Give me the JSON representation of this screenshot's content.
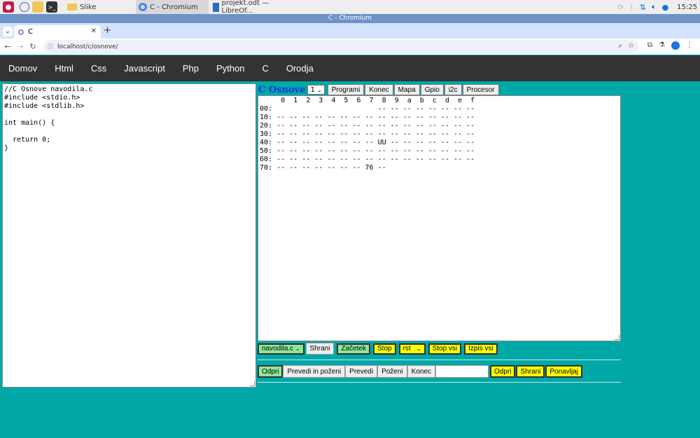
{
  "taskbar": {
    "tasks": [
      {
        "label": "Slike"
      },
      {
        "label": "C - Chromium"
      },
      {
        "label": "projekt.odt — LibreOf..."
      }
    ],
    "clock": "15:25"
  },
  "window": {
    "title": "C - Chromium"
  },
  "browser": {
    "tab_title": "C",
    "url": "localhost/c/osnove/"
  },
  "site_nav": [
    "Domov",
    "Html",
    "Css",
    "Javascript",
    "Php",
    "Python",
    "C",
    "Orodja"
  ],
  "editor": {
    "code": "//C Osnove navodila.c\n#include <stdio.h>\n#include <stdlib.h>\n\nint main() {\n\n  return 0;\n}"
  },
  "panel": {
    "heading": "C Osnove",
    "number_select": "1",
    "top_buttons": [
      "Programi",
      "Konec",
      "Mapa",
      "Gpio",
      "i2c",
      "Procesor"
    ],
    "output": "     0  1  2  3  4  5  6  7  8  9  a  b  c  d  e  f\n00:                         -- -- -- -- -- -- -- --\n10: -- -- -- -- -- -- -- -- -- -- -- -- -- -- -- --\n20: -- -- -- -- -- -- -- -- -- -- -- -- -- -- -- --\n30: -- -- -- -- -- -- -- -- -- -- -- -- -- -- -- --\n40: -- -- -- -- -- -- -- -- UU -- -- -- -- -- -- --\n50: -- -- -- -- -- -- -- -- -- -- -- -- -- -- -- --\n60: -- -- -- -- -- -- -- -- -- -- -- -- -- -- -- --\n70: -- -- -- -- -- -- -- 76 --",
    "file_select": "navodila.c",
    "row3": {
      "shrani": "Shrani",
      "zacetek": "Začetek",
      "stop": "Stop",
      "rst_select": "rst",
      "stop_vsi": "Stop vsi",
      "izpis_vsi": "Izpis vsi"
    },
    "row4": {
      "odpri": "Odpri",
      "prevedi_pozeni": "Prevedi in poženi",
      "prevedi": "Prevedi",
      "pozeni": "Poženi",
      "konec": "Konec",
      "input_value": "",
      "odpri2": "Odpri",
      "shrani2": "Shrani",
      "ponavljaj": "Ponavljaj"
    }
  }
}
